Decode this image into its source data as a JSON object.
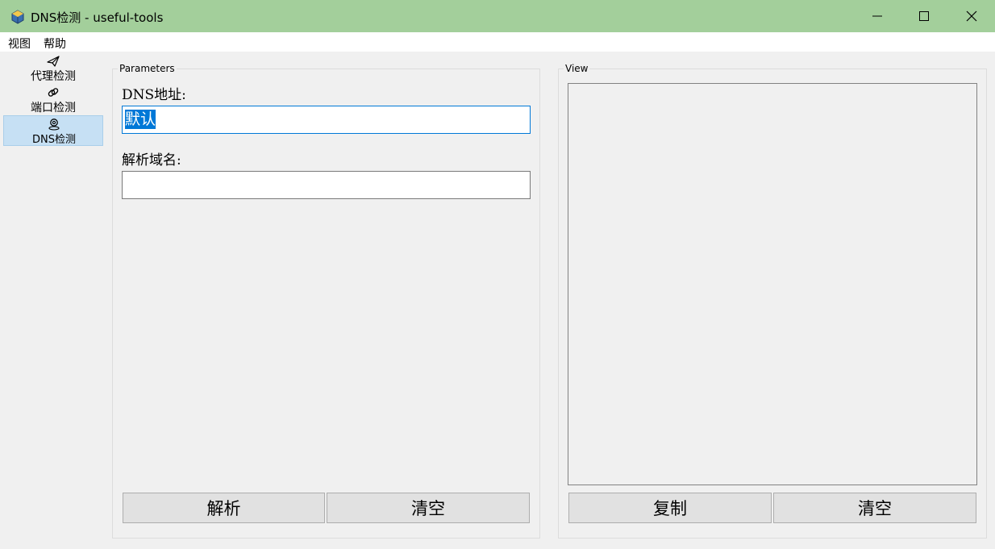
{
  "window": {
    "title": "DNS检测 - useful-tools",
    "app_icon": "cube-icon",
    "controls": [
      "minimize-icon",
      "maximize-icon",
      "close-icon"
    ]
  },
  "menu": {
    "view": "视图",
    "help": "帮助"
  },
  "sidebar": {
    "items": [
      {
        "label": "代理检测",
        "icon": "paper-plane-icon",
        "active": false
      },
      {
        "label": "端口检测",
        "icon": "link-icon",
        "active": false
      },
      {
        "label": "DNS检测",
        "icon": "location-pin-icon",
        "active": true
      }
    ]
  },
  "parameters": {
    "title": "Parameters",
    "dns_label": "DNS地址:",
    "dns_value": "默认",
    "domain_label": "解析域名:",
    "domain_value": "",
    "resolve_button": "解析",
    "clear_button": "清空"
  },
  "view": {
    "title": "View",
    "output": "",
    "copy_button": "复制",
    "clear_button": "清空"
  },
  "colors": {
    "titlebar": "#a3cf9b",
    "selection": "#0078d7",
    "active_nav": "#c6e0f4"
  }
}
